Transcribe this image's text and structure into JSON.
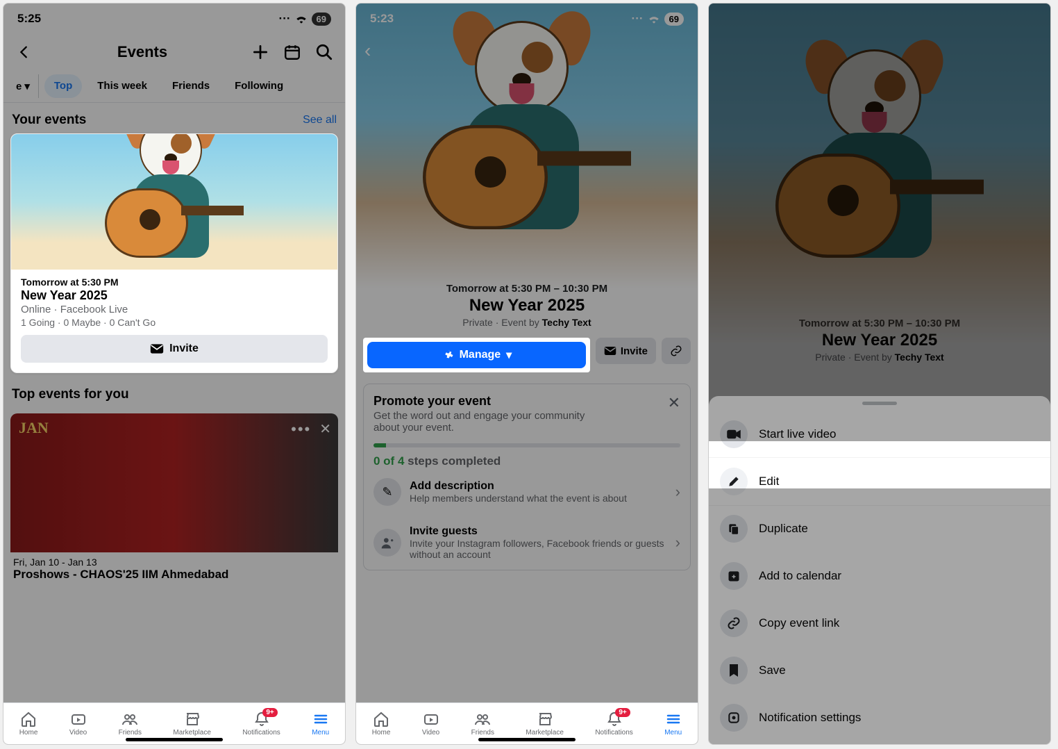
{
  "status": {
    "time1": "5:25",
    "time2": "5:23",
    "battery": "69"
  },
  "screen1": {
    "header": "Events",
    "chips": {
      "for_you_suffix": "e",
      "top": "Top",
      "week": "This week",
      "friends": "Friends",
      "following": "Following"
    },
    "your_events": {
      "title": "Your events",
      "see_all": "See all"
    },
    "card": {
      "when": "Tomorrow at 5:30 PM",
      "title": "New Year 2025",
      "where": "Online · Facebook Live",
      "stats": "1 Going · 0 Maybe · 0 Can't Go",
      "invite": "Invite"
    },
    "top_events": {
      "title": "Top events for you",
      "date": "Fri, Jan 10 - Jan 13",
      "name": "Proshows - CHAOS'25 IIM Ahmedabad"
    }
  },
  "screen2": {
    "when": "Tomorrow at 5:30 PM – 10:30 PM",
    "title": "New Year 2025",
    "sub_prefix": "Private · Event by ",
    "sub_bold": "Techy Text",
    "manage": "Manage",
    "invite": "Invite",
    "promote": {
      "title": "Promote your event",
      "sub": "Get the word out and engage your community about your event.",
      "steps_count": "0 of 4",
      "steps_suffix": " steps completed",
      "step1_title": "Add description",
      "step1_sub": "Help members understand what the event is about",
      "step2_title": "Invite guests",
      "step2_sub": "Invite your Instagram followers, Facebook friends or guests without an account"
    }
  },
  "screen3": {
    "when": "Tomorrow at 5:30 PM – 10:30 PM",
    "title": "New Year 2025",
    "sub_prefix": "Private · Event by ",
    "sub_bold": "Techy Text",
    "items": {
      "live": "Start live video",
      "edit": "Edit",
      "dup": "Duplicate",
      "cal": "Add to calendar",
      "link": "Copy event link",
      "save": "Save",
      "notif": "Notification settings"
    }
  },
  "tabs": {
    "home": "Home",
    "video": "Video",
    "friends": "Friends",
    "market": "Marketplace",
    "notif": "Notifications",
    "menu": "Menu",
    "badge": "9+"
  }
}
